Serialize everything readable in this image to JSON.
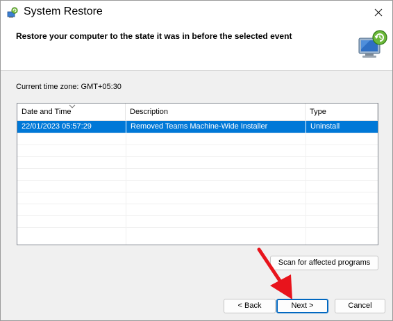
{
  "window": {
    "title": "System Restore",
    "close_label": "Close"
  },
  "header": {
    "instruction": "Restore your computer to the state it was in before the selected event"
  },
  "timezone_text": "Current time zone: GMT+05:30",
  "table": {
    "columns": [
      "Date and Time",
      "Description",
      "Type"
    ],
    "sort_column": "Date and Time",
    "rows": [
      {
        "date_time": "22/01/2023 05:57:29",
        "description": "Removed Teams Machine-Wide Installer",
        "type": "Uninstall",
        "selected": true
      }
    ]
  },
  "buttons": {
    "scan": "Scan for affected programs",
    "back": "< Back",
    "next": "Next >",
    "cancel": "Cancel"
  },
  "colors": {
    "selection": "#0078d7",
    "annotation_arrow": "#e8141c",
    "default_button_border": "#0067c0"
  },
  "icons": {
    "app": "system-restore-icon",
    "header": "restore-computer-icon",
    "close": "close-icon",
    "sort": "sort-descending-icon"
  }
}
